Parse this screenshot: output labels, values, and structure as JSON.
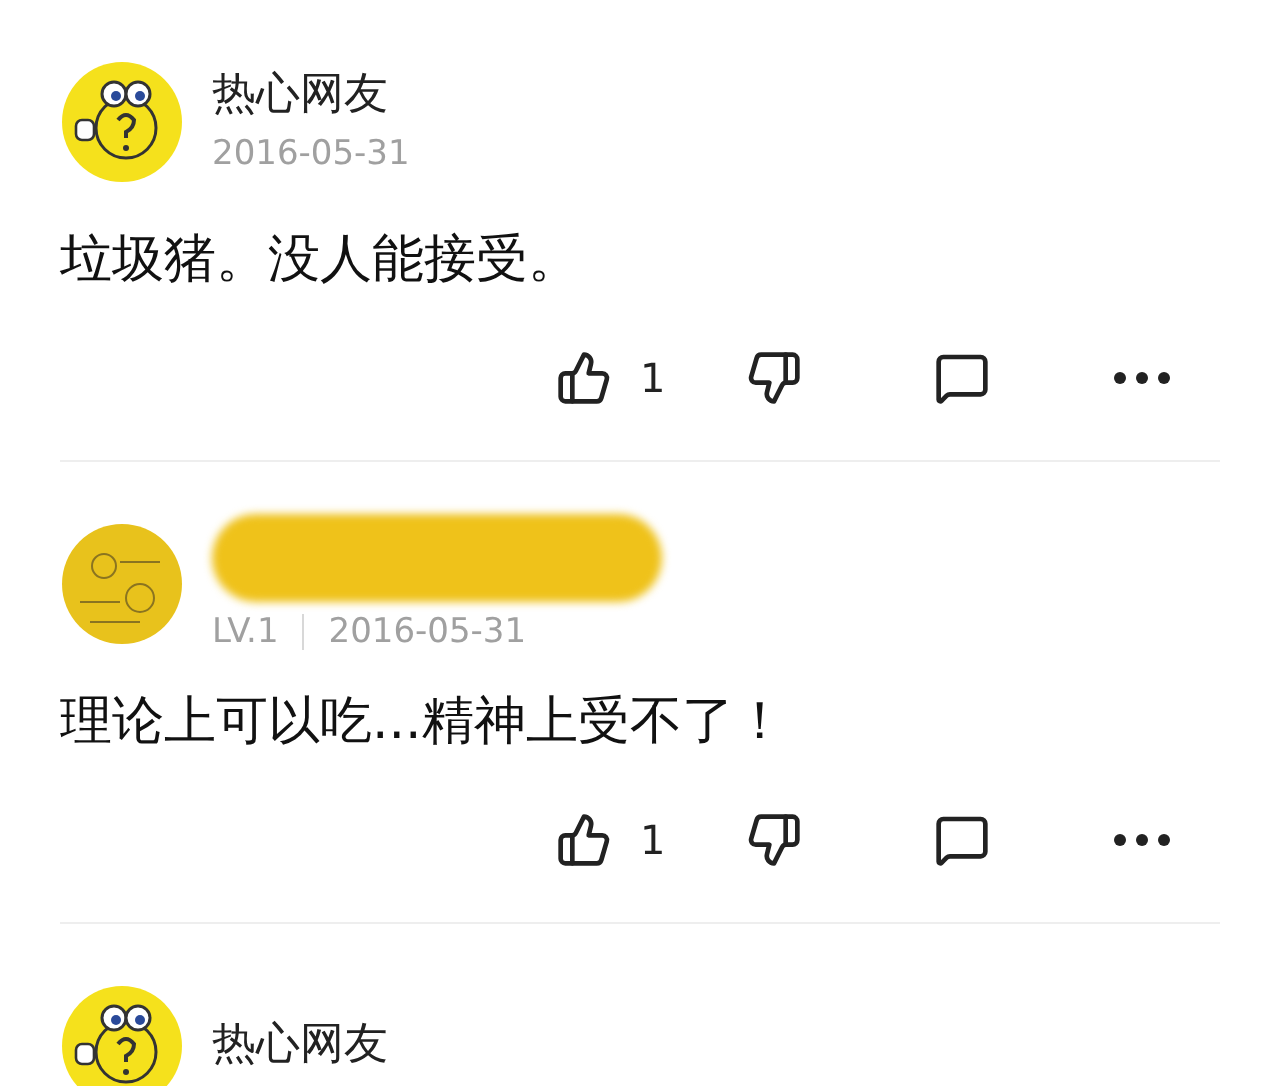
{
  "comments": [
    {
      "kind": "emoticon",
      "user": "热心网友",
      "name_obscured": false,
      "date": "2016-05-31",
      "text": "垃圾猪。没人能接受。",
      "likes": "1"
    },
    {
      "kind": "obscured",
      "name_obscured": true,
      "level": "LV.1",
      "date": "2016-05-31",
      "text": "理论上可以吃...精神上受不了！",
      "likes": "1"
    },
    {
      "kind": "emoticon",
      "user": "热心网友",
      "name_obscured": false
    }
  ]
}
